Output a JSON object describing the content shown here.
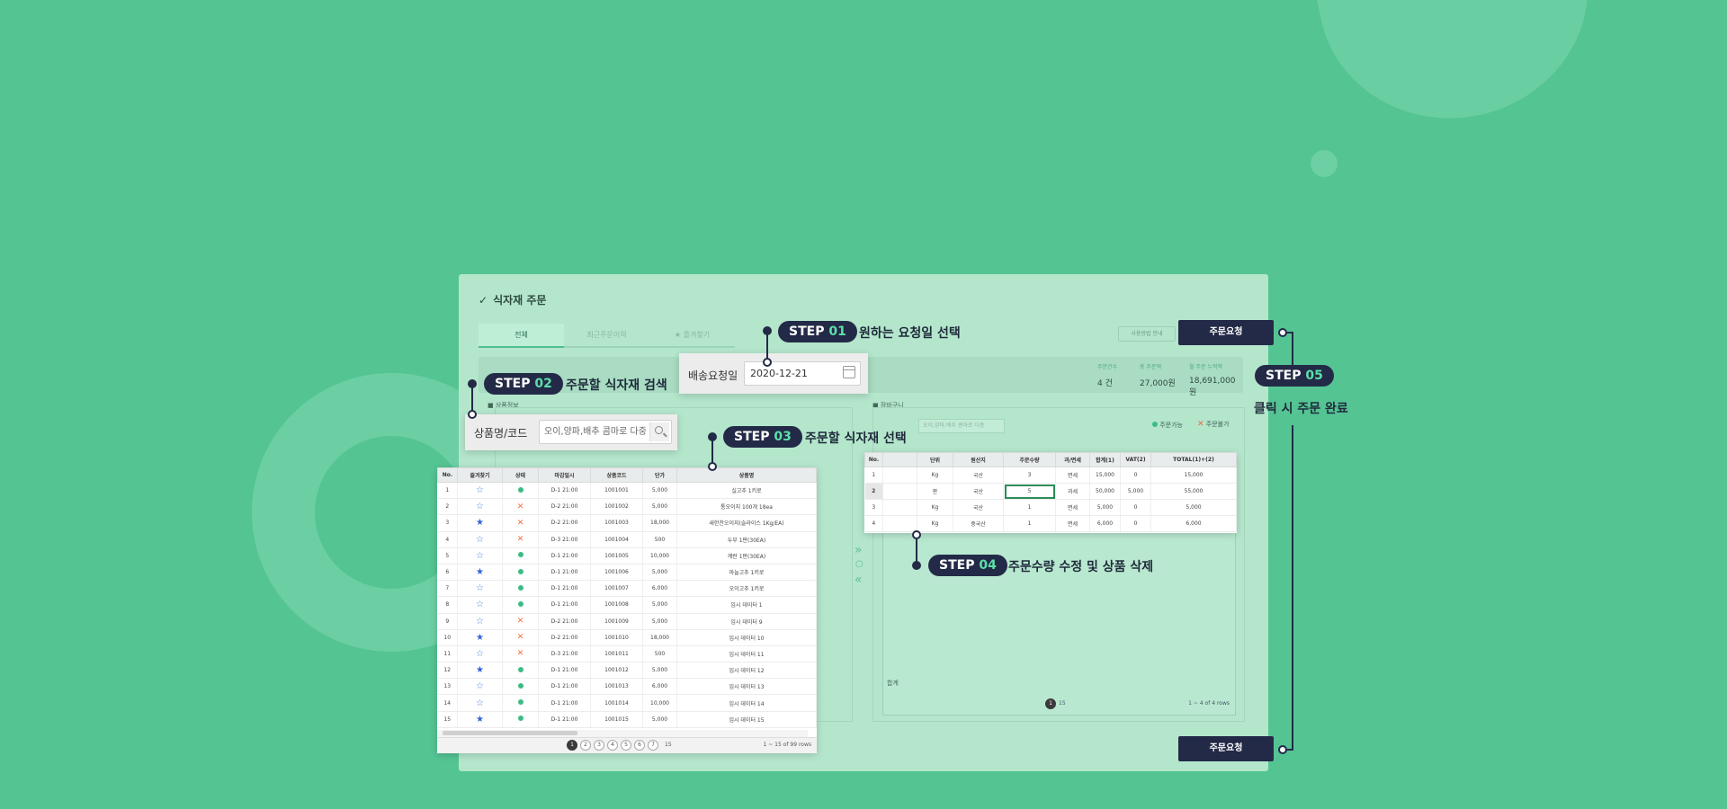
{
  "panel": {
    "title": "식자재 주문",
    "tabs": [
      {
        "label": "전체"
      },
      {
        "label": "최근주문이력"
      },
      {
        "label": "★ 즐겨찾기"
      }
    ],
    "guide_button": "사용방법 안내",
    "summary": [
      {
        "label": "주문건수",
        "value": "4 건"
      },
      {
        "label": "총 주문액",
        "value": "27,000원"
      },
      {
        "label": "월 주문 누적액",
        "value": "18,691,000 원"
      }
    ],
    "product_section": "■ 상품정보",
    "cart_section": "■ 장바구니",
    "cart_search_placeholder": "오이,양파,배추 콩마로 다중",
    "legend_available": "주문가능",
    "legend_unavailable": "주문불가",
    "cart_total_label": "합계",
    "cart_footer_page": "1",
    "cart_footer_size": "15",
    "cart_footer_info": "1 ~ 4 of 4 rows",
    "move_right": "»",
    "move_mid": "○",
    "move_left": "«"
  },
  "date_popup": {
    "label": "배송요청일",
    "value": "2020-12-21"
  },
  "search_popup": {
    "label": "상품명/코드",
    "placeholder": "오이,양파,배추 콤마로 다중"
  },
  "product_grid": {
    "columns": [
      "No.",
      "즐겨찾기",
      "상태",
      "마감일시",
      "상품코드",
      "단가",
      "상품명"
    ],
    "rows": [
      {
        "no": "1",
        "fav": false,
        "ok": true,
        "deadline": "D-1 21:00",
        "code": "1001001",
        "price": "5,000",
        "name": "실고추 1키로"
      },
      {
        "no": "2",
        "fav": false,
        "ok": false,
        "deadline": "D-2 21:00",
        "code": "1001002",
        "price": "5,000",
        "name": "통오이지 100개 18ea"
      },
      {
        "no": "3",
        "fav": true,
        "ok": false,
        "deadline": "D-2 21:00",
        "code": "1001003",
        "price": "18,000",
        "name": "새한찬오이지(슬라이스 1Kg/EA)"
      },
      {
        "no": "4",
        "fav": false,
        "ok": false,
        "deadline": "D-3 21:00",
        "code": "1001004",
        "price": "500",
        "name": "두부 1판(30EA)"
      },
      {
        "no": "5",
        "fav": false,
        "ok": true,
        "deadline": "D-1 21:00",
        "code": "1001005",
        "price": "10,000",
        "name": "계란 1판(30EA)"
      },
      {
        "no": "6",
        "fav": true,
        "ok": true,
        "deadline": "D-1 21:00",
        "code": "1001006",
        "price": "5,000",
        "name": "마늘고추 1키로"
      },
      {
        "no": "7",
        "fav": false,
        "ok": true,
        "deadline": "D-1 21:00",
        "code": "1001007",
        "price": "6,000",
        "name": "오이고추 1키로"
      },
      {
        "no": "8",
        "fav": false,
        "ok": true,
        "deadline": "D-1 21:00",
        "code": "1001008",
        "price": "5,000",
        "name": "임시 데이터 1"
      },
      {
        "no": "9",
        "fav": false,
        "ok": false,
        "deadline": "D-2 21:00",
        "code": "1001009",
        "price": "5,000",
        "name": "임시 데이터 9"
      },
      {
        "no": "10",
        "fav": true,
        "ok": false,
        "deadline": "D-2 21:00",
        "code": "1001010",
        "price": "18,000",
        "name": "임시 데이터 10"
      },
      {
        "no": "11",
        "fav": false,
        "ok": false,
        "deadline": "D-3 21:00",
        "code": "1001011",
        "price": "500",
        "name": "임시 데이터 11"
      },
      {
        "no": "12",
        "fav": true,
        "ok": true,
        "deadline": "D-1 21:00",
        "code": "1001012",
        "price": "5,000",
        "name": "임시 데이터 12"
      },
      {
        "no": "13",
        "fav": false,
        "ok": true,
        "deadline": "D-1 21:00",
        "code": "1001013",
        "price": "6,000",
        "name": "임시 데이터 13"
      },
      {
        "no": "14",
        "fav": false,
        "ok": true,
        "deadline": "D-1 21:00",
        "code": "1001014",
        "price": "10,000",
        "name": "임시 데이터 14"
      },
      {
        "no": "15",
        "fav": true,
        "ok": true,
        "deadline": "D-1 21:00",
        "code": "1001015",
        "price": "5,000",
        "name": "임시 데이터 15"
      }
    ],
    "pages": [
      "1",
      "2",
      "3",
      "4",
      "5",
      "6",
      "7"
    ],
    "current_page": "1",
    "page_size": "15",
    "info": "1 ~ 15 of 99 rows"
  },
  "cart_grid": {
    "columns": [
      "No.",
      "",
      "단위",
      "원산지",
      "주문수량",
      "과/면세",
      "합계(1)",
      "VAT(2)",
      "TOTAL(1)+(2)"
    ],
    "rows": [
      {
        "no": "1",
        "unit": "Kg",
        "origin": "국산",
        "qty": "3",
        "tax": "면세",
        "sum": "15,000",
        "vat": "0",
        "total": "15,000"
      },
      {
        "no": "2",
        "unit": "판",
        "origin": "국산",
        "qty": "5",
        "tax": "과세",
        "sum": "50,000",
        "vat": "5,000",
        "total": "55,000"
      },
      {
        "no": "3",
        "unit": "Kg",
        "origin": "국산",
        "qty": "1",
        "tax": "면세",
        "sum": "5,000",
        "vat": "0",
        "total": "5,000"
      },
      {
        "no": "4",
        "unit": "Kg",
        "origin": "중국산",
        "qty": "1",
        "tax": "면세",
        "sum": "6,000",
        "vat": "0",
        "total": "6,000"
      }
    ]
  },
  "steps": [
    {
      "prefix": "STEP ",
      "num": "01",
      "text": "원하는 요청일 선택"
    },
    {
      "prefix": "STEP ",
      "num": "02",
      "text": "주문할 식자재 검색"
    },
    {
      "prefix": "STEP ",
      "num": "03",
      "text": "주문할 식자재 선택"
    },
    {
      "prefix": "STEP ",
      "num": "04",
      "text": "주문수량 수정 및 상품 삭제"
    },
    {
      "prefix": "STEP ",
      "num": "05",
      "text": "클릭 시 주문 완료"
    }
  ],
  "order_button": "주문요청",
  "colors": {
    "background": "#54c493",
    "accent": "#232a47",
    "step_number": "#5be0a8"
  }
}
